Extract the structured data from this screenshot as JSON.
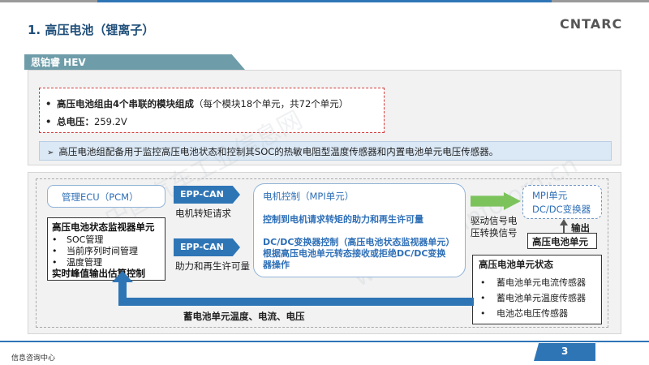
{
  "header": {
    "title": "1. 高压电池（锂离子）",
    "logo": "CNTARC"
  },
  "section": {
    "label": "思铂睿 HEV"
  },
  "specs": {
    "line1_bold": "高压电池组由4个串联的模块组成",
    "line1_rest": "（每个模块18个单元，共72个单元）",
    "line2_bold": "总电压：",
    "line2_rest": "259.2V"
  },
  "note": "高压电池组配备用于监控高压电池状态和控制其SOC的热敏电阻型温度传感器和内置电池单元电压传感器。",
  "diagram": {
    "ecu": "管理ECU（PCM）",
    "monitor_title": "高压电池状态监视器单元",
    "monitor_items": [
      "SOC管理",
      "当前序列时间管理",
      "温度管理"
    ],
    "monitor_footer": "实时峰值输出估算控制",
    "arrow1_label": "EPP-CAN",
    "arrow1_caption": "电机转矩请求",
    "arrow2_label": "EPP-CAN",
    "arrow2_caption": "助力和再生许可量",
    "mpi_control_title": "电机控制（MPI单元）",
    "mpi_control_line1": "控制到电机请求转矩的助力和再生许可量",
    "mpi_dcdc_title": "DC/DC变换器控制（高压电池状态监视器单元）",
    "mpi_dcdc_line1": "根据高压电池单元转态接收或拒绝DC/DC变换",
    "mpi_dcdc_line2": "器操作",
    "drive_signal_line1": "驱动信号电",
    "drive_signal_line2": "压转换信号",
    "mpi_unit_line1": "MPI单元",
    "mpi_unit_line2": "DC/DC变换器",
    "output_label": "输出",
    "hv_unit": "高压电池单元",
    "hv_status_title": "高压电池单元状态",
    "hv_status_items": [
      "蓄电池单元电流传感器",
      "蓄电池单元温度传感器",
      "电池芯电压传感器"
    ],
    "return_label": "蓄电池单元温度、电流、电压"
  },
  "footer": {
    "org": "信息咨询中心",
    "page": "3"
  },
  "watermark": {
    "text1": "中国汽车工业信息网",
    "text2": "www.autoinfo.org.cn"
  },
  "colors": {
    "title": "#1f4e79",
    "accent_blue": "#2e75b6",
    "section_bar": "#6e9da9",
    "green_arrow": "#7cc35c",
    "spec_border": "#d23b3b"
  }
}
